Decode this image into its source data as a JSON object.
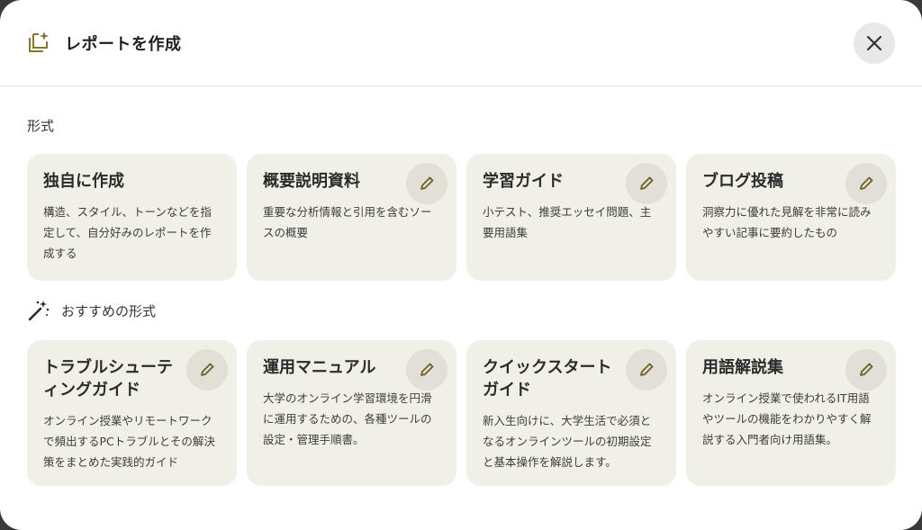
{
  "header": {
    "title": "レポートを作成",
    "icon": "report-sparkle-icon",
    "close_icon": "close-icon"
  },
  "formats": {
    "label": "形式",
    "cards": [
      {
        "title": "独自に作成",
        "desc": "構造、スタイル、トーンなどを指定して、自分好みのレポートを作成する",
        "editable": false
      },
      {
        "title": "概要説明資料",
        "desc": "重要な分析情報と引用を含むソースの概要",
        "editable": true
      },
      {
        "title": "学習ガイド",
        "desc": "小テスト、推奨エッセイ問題、主要用語集",
        "editable": true
      },
      {
        "title": "ブログ投稿",
        "desc": "洞察力に優れた見解を非常に読みやすい記事に要約したもの",
        "editable": true
      }
    ]
  },
  "recommended": {
    "label": "おすすめの形式",
    "icon": "magic-wand-icon",
    "cards": [
      {
        "title": "トラブルシューティングガイド",
        "desc": "オンライン授業やリモートワークで頻出するPCトラブルとその解決策をまとめた実践的ガイド",
        "editable": true
      },
      {
        "title": "運用マニュアル",
        "desc": "大学のオンライン学習環境を円滑に運用するための、各種ツールの設定・管理手順書。",
        "editable": true
      },
      {
        "title": "クイックスタートガイド",
        "desc": "新入生向けに、大学生活で必須となるオンラインツールの初期設定と基本操作を解説します。",
        "editable": true
      },
      {
        "title": "用語解説集",
        "desc": "オンライン授業で使われるIT用語やツールの機能をわかりやすく解説する入門者向け用語集。",
        "editable": true
      }
    ]
  },
  "colors": {
    "card_bg": "#f1f0e8",
    "accent_icon": "#7a6a2a",
    "edit_bg": "#e2e0d6"
  }
}
